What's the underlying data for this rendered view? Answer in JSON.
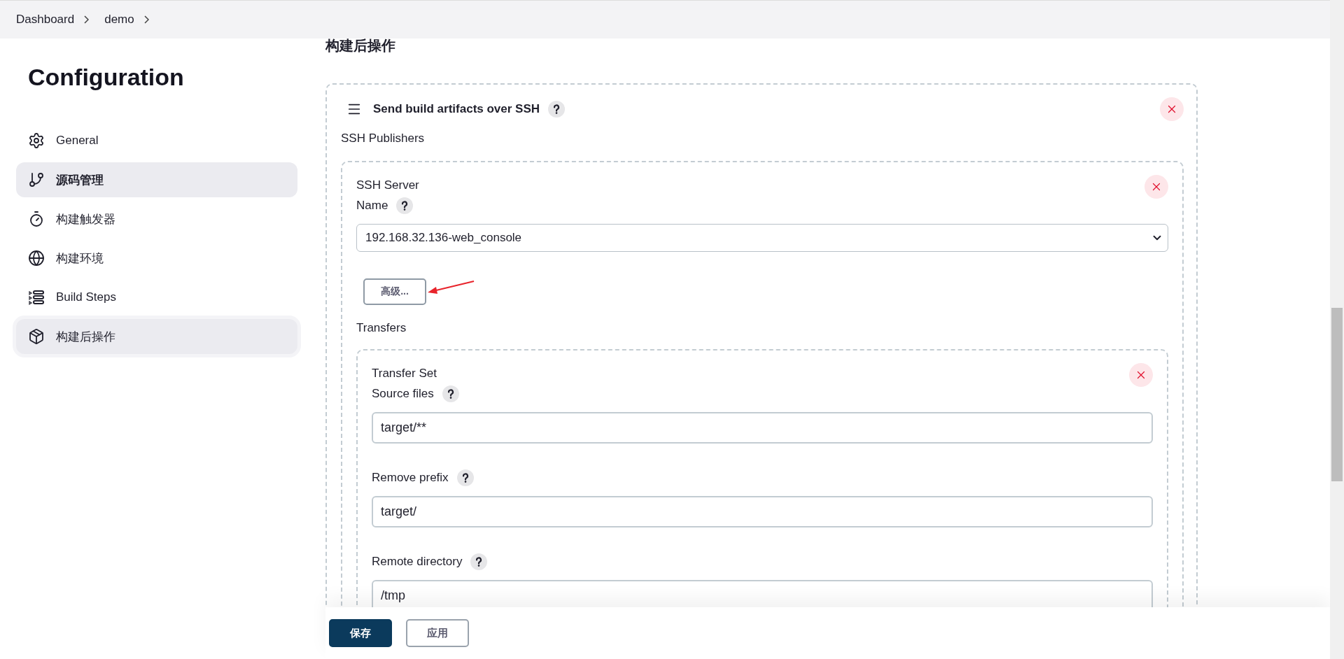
{
  "breadcrumb": [
    {
      "label": "Dashboard"
    },
    {
      "label": "demo"
    }
  ],
  "sidebar": {
    "title": "Configuration",
    "items": [
      {
        "label": "General",
        "selected": false,
        "hovered": false
      },
      {
        "label": "源码管理",
        "selected": true,
        "hovered": false
      },
      {
        "label": "构建触发器",
        "selected": false,
        "hovered": false
      },
      {
        "label": "构建环境",
        "selected": false,
        "hovered": false
      },
      {
        "label": "Build Steps",
        "selected": false,
        "hovered": false
      },
      {
        "label": "构建后操作",
        "selected": false,
        "hovered": true
      }
    ]
  },
  "section": {
    "title": "构建后操作"
  },
  "publisher": {
    "title": "Send build artifacts over SSH",
    "subtitle": "SSH Publishers",
    "server": {
      "title": "SSH Server",
      "name_label": "Name",
      "name_value": "192.168.32.136-web_console",
      "advanced_button": "高级...",
      "transfers_label": "Transfers",
      "transfer_set": {
        "title": "Transfer Set",
        "fields": [
          {
            "label": "Source files",
            "value": "target/**"
          },
          {
            "label": "Remove prefix",
            "value": "target/"
          },
          {
            "label": "Remote directory",
            "value": "/tmp"
          }
        ]
      }
    }
  },
  "actions": [
    {
      "label": "保存",
      "kind": "primary"
    },
    {
      "label": "应用",
      "kind": "secondary"
    }
  ]
}
